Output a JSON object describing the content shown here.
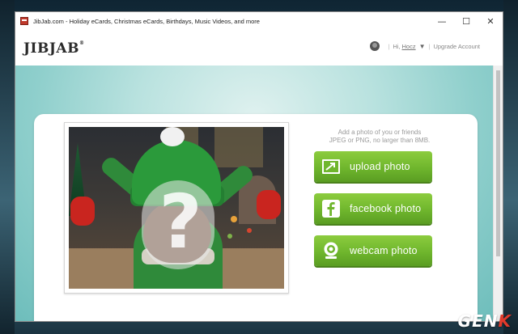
{
  "window": {
    "title": "JibJab.com - Holiday eCards, Christmas eCards, Birthdays, Music Videos, and more",
    "controls": {
      "minimize": "—",
      "maximize": "☐",
      "close": "✕"
    }
  },
  "header": {
    "logo": "JIBJAB",
    "logo_tm": "®",
    "greeting": "Hi,",
    "username": "Hocz",
    "upgrade_label": "Upgrade Account"
  },
  "main": {
    "instructions_line1": "Add a photo of you or friends",
    "instructions_line2": "JPEG or PNG, no larger than 8MB.",
    "buttons": [
      {
        "label": "upload photo",
        "icon": "upload-photo-icon"
      },
      {
        "label": "facebook photo",
        "icon": "facebook-icon"
      },
      {
        "label": "webcam photo",
        "icon": "webcam-icon"
      }
    ],
    "placeholder_mark": "?"
  },
  "watermark": {
    "part1": "GEN",
    "part2": "K"
  },
  "colors": {
    "button_green": "#6fb62d",
    "teal_background": "#8fcfcc",
    "brand_red": "#c0392b"
  }
}
